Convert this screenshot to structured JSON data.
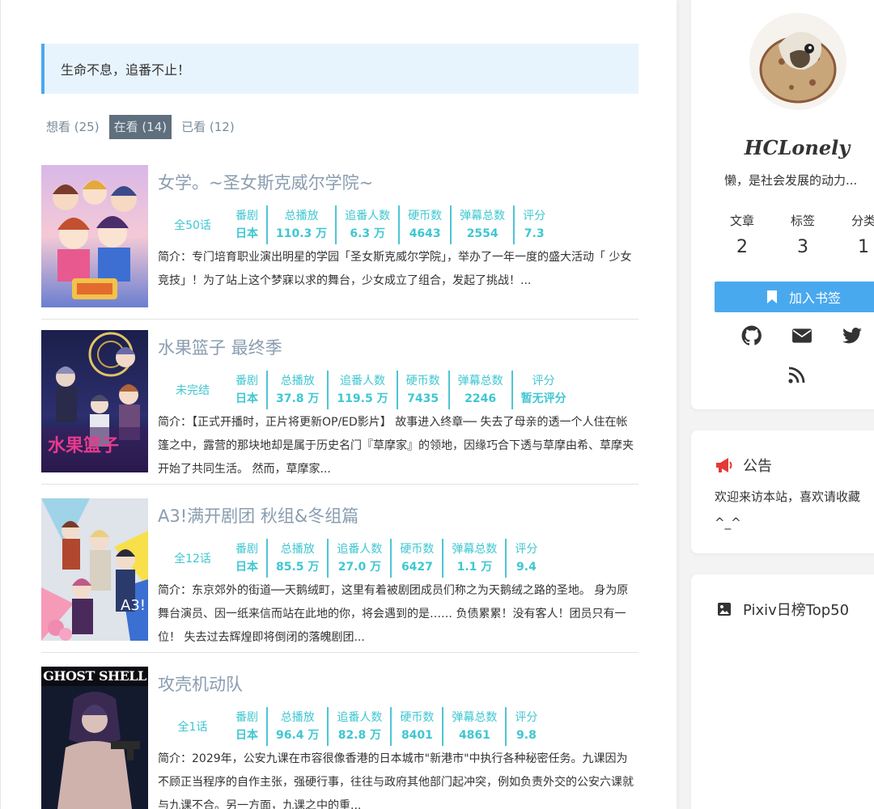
{
  "notice": "生命不息，追番不止！",
  "tabs": [
    {
      "label": "想看 (25)"
    },
    {
      "label": "在看 (14)"
    },
    {
      "label": "已看 (12)"
    }
  ],
  "stat_labels": [
    "番剧",
    "总播放",
    "追番人数",
    "硬币数",
    "弹幕总数",
    "评分"
  ],
  "items": [
    {
      "title": "女学。~圣女斯克威尔学院~",
      "episodes": "全50话",
      "values": [
        "日本",
        "110.3 万",
        "6.3 万",
        "4643",
        "2554",
        "7.3"
      ],
      "desc": "简介：专门培育职业演出明星的学园「圣女斯克威尔学院」，举办了一年一度的盛大活动「 少女竞技」！为了站上这个梦寐以求的舞台，少女成立了组合，发起了挑战！..."
    },
    {
      "title": "水果篮子 最终季",
      "episodes": "未完结",
      "values": [
        "日本",
        "37.8 万",
        "119.5 万",
        "7435",
        "2246",
        "暂无评分"
      ],
      "desc": "简介：【正式开播时，正片将更新OP/ED影片】 故事进入终章── 失去了母亲的透一个人住在帐篷之中，露营的那块地却是属于历史名门『草摩家』的领地，因缘巧合下透与草摩由希、草摩夹开始了共同生活。 然而，草摩家..."
    },
    {
      "title": "A3!满开剧团 秋组&冬组篇",
      "episodes": "全12话",
      "values": [
        "日本",
        "85.5 万",
        "27.0 万",
        "6427",
        "1.1 万",
        "9.4"
      ],
      "desc": "简介：东京郊外的街道──天鹅绒町，这里有着被剧团成员们称之为天鹅绒之路的圣地。 身为原舞台演员、因一纸来信而站在此地的你，将会遇到的是…… 负债累累！没有客人！团员只有一位！ 失去过去辉煌即将倒闭的落魄剧团..."
    },
    {
      "title": "攻壳机动队",
      "episodes": "全1话",
      "values": [
        "日本",
        "96.4 万",
        "82.8 万",
        "8401",
        "4861",
        "9.8"
      ],
      "desc": "简介：2029年，公安九课在市容很像香港的日本城市\"新港市\"中执行各种秘密任务。九课因为不顾正当程序的自作主张，强硬行事，往往与政府其他部门起冲突，例如负责外交的公安六课就与九课不合。另一方面，九课之中的重...",
      "cover_text": "GHOST SHELL"
    }
  ],
  "profile": {
    "username": "HCLonely",
    "motto": "懒，是社会发展的动力...",
    "counts": [
      {
        "label": "文章",
        "value": "2"
      },
      {
        "label": "标签",
        "value": "3"
      },
      {
        "label": "分类",
        "value": "1"
      }
    ],
    "bookmark_label": "加入书签"
  },
  "announcement": {
    "title": "公告",
    "body_line1": "欢迎来访本站，喜欢请收藏",
    "body_line2": "^_^"
  },
  "pixiv": {
    "title": "Pixiv日榜Top50"
  },
  "colors": {
    "accent": "#49a9ee",
    "stat": "#3fc7d1",
    "title": "#8a9db0",
    "megaphone": "#e53935"
  }
}
